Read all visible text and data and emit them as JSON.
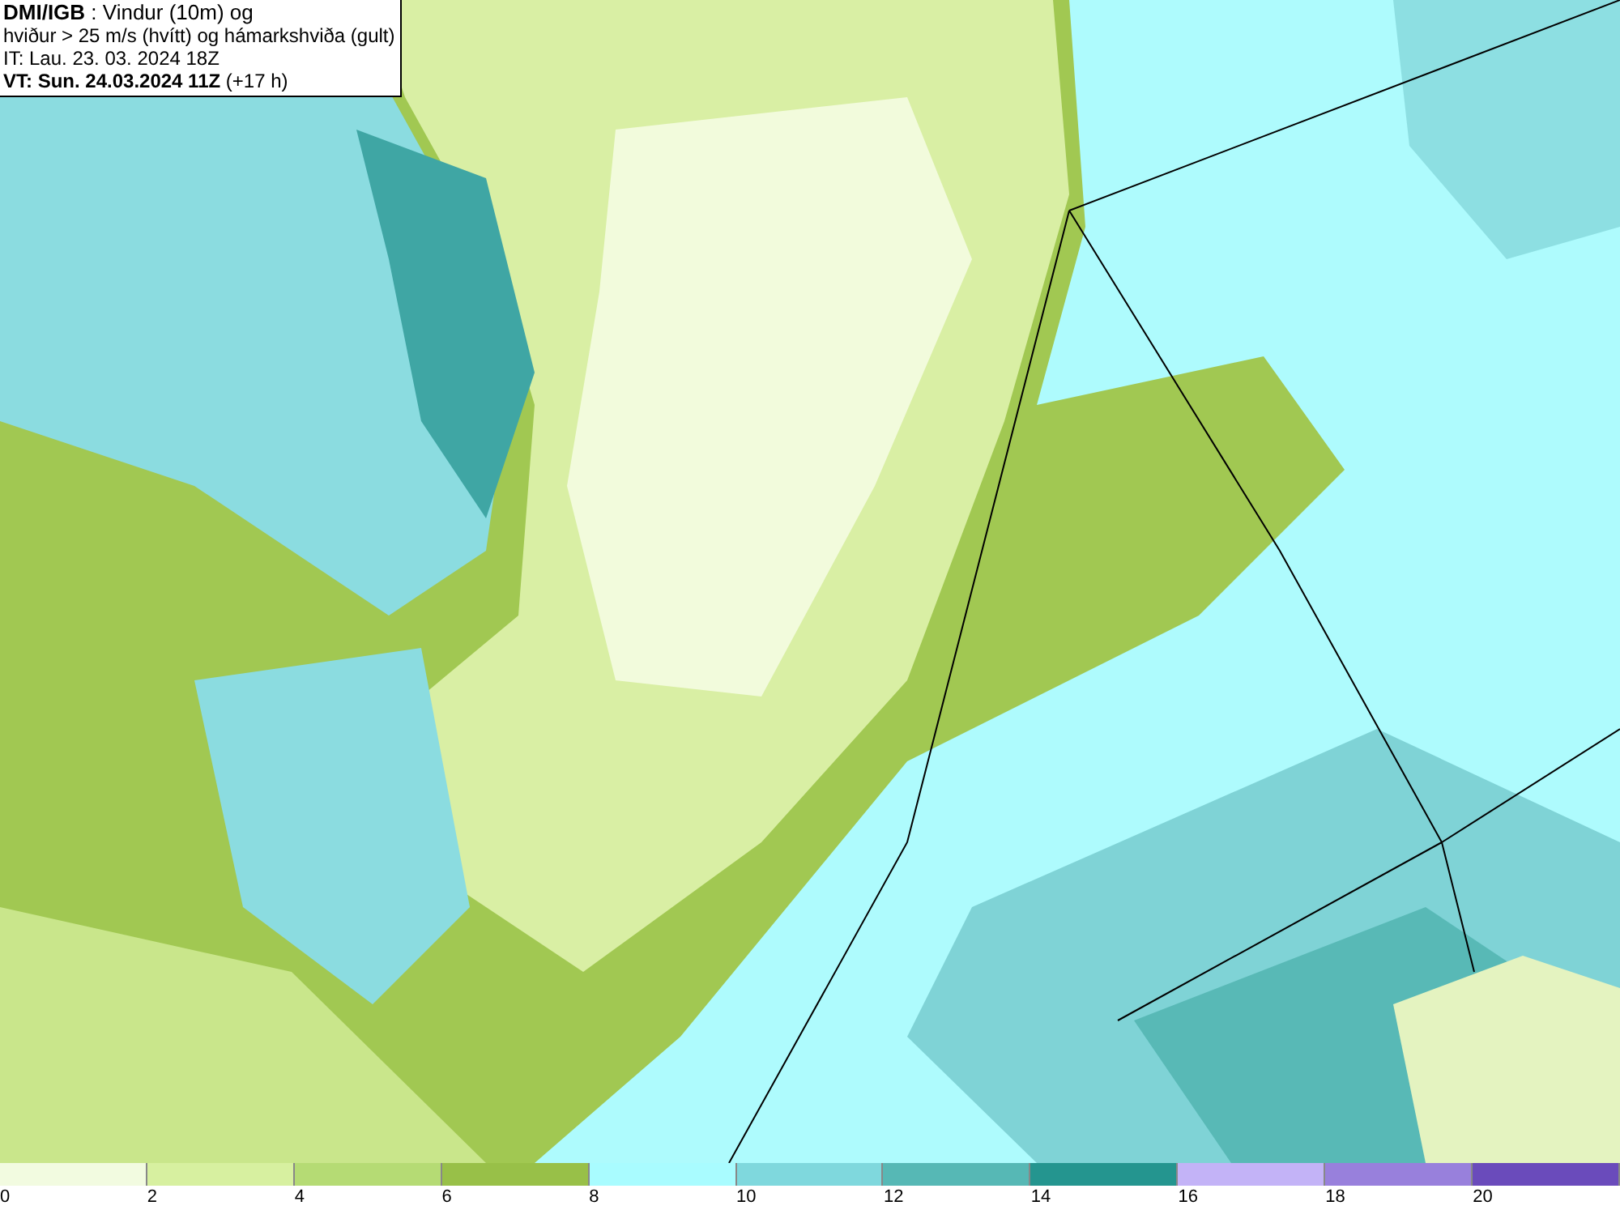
{
  "header": {
    "lines": [
      "**DMI/IGB** : Vindur (10m) og",
      "hviður > 25 m/s (hvítt) og hámarkshviða (gult)",
      "IT: Lau. 23. 03. 2024 18Z",
      "**VT: Sun. 24.03.2024 11Z** (+17 h)"
    ]
  },
  "legend": {
    "segments": [
      {
        "color": "#f2fbe0"
      },
      {
        "color": "#d7f0a0"
      },
      {
        "color": "#b5db74"
      },
      {
        "color": "#98c048"
      },
      {
        "color": "#a9fcff"
      },
      {
        "color": "#7fd8dd"
      },
      {
        "color": "#56b8b5"
      },
      {
        "color": "#24958f"
      },
      {
        "color": "#c3b3f7"
      },
      {
        "color": "#9880dc"
      },
      {
        "color": "#6a4bbb"
      }
    ],
    "ticks": [
      "0",
      "2",
      "4",
      "6",
      "8",
      "10",
      "12",
      "14",
      "16",
      "18",
      "20"
    ]
  }
}
